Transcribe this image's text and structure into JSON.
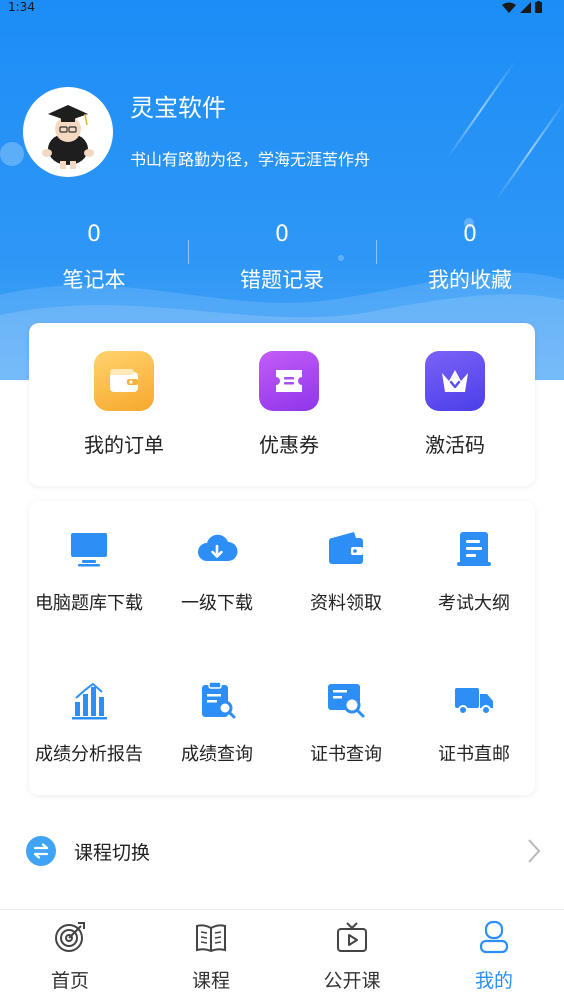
{
  "status_bar": {
    "time": "1:34"
  },
  "profile": {
    "name": "灵宝软件",
    "motto": "书山有路勤为径，学海无涯苦作舟"
  },
  "stats": [
    {
      "value": "0",
      "label": "笔记本"
    },
    {
      "value": "0",
      "label": "错题记录"
    },
    {
      "value": "0",
      "label": "我的收藏"
    }
  ],
  "quick_actions": [
    {
      "label": "我的订单",
      "icon": "wallet-icon",
      "color": "#fbbd48"
    },
    {
      "label": "优惠券",
      "icon": "coupon-icon",
      "color": "#a64ef3"
    },
    {
      "label": "激活码",
      "icon": "crown-icon",
      "color": "#5a4ef0"
    }
  ],
  "services": [
    {
      "label": "电脑题库下载",
      "icon": "monitor-icon"
    },
    {
      "label": "一级下载",
      "icon": "cloud-download-icon"
    },
    {
      "label": "资料领取",
      "icon": "wallet-icon"
    },
    {
      "label": "考试大纲",
      "icon": "scroll-icon"
    },
    {
      "label": "成绩分析报告",
      "icon": "bar-chart-icon"
    },
    {
      "label": "成绩查询",
      "icon": "clipboard-search-icon"
    },
    {
      "label": "证书查询",
      "icon": "certificate-search-icon"
    },
    {
      "label": "证书直邮",
      "icon": "truck-icon"
    }
  ],
  "course_switch": {
    "label": "课程切换"
  },
  "tabs": [
    {
      "label": "首页",
      "icon": "target-icon",
      "active": false
    },
    {
      "label": "课程",
      "icon": "book-icon",
      "active": false
    },
    {
      "label": "公开课",
      "icon": "tv-play-icon",
      "active": false
    },
    {
      "label": "我的",
      "icon": "user-icon",
      "active": true
    }
  ],
  "colors": {
    "primary": "#2d8ff5",
    "icon_blue": "#2d8ff5"
  }
}
